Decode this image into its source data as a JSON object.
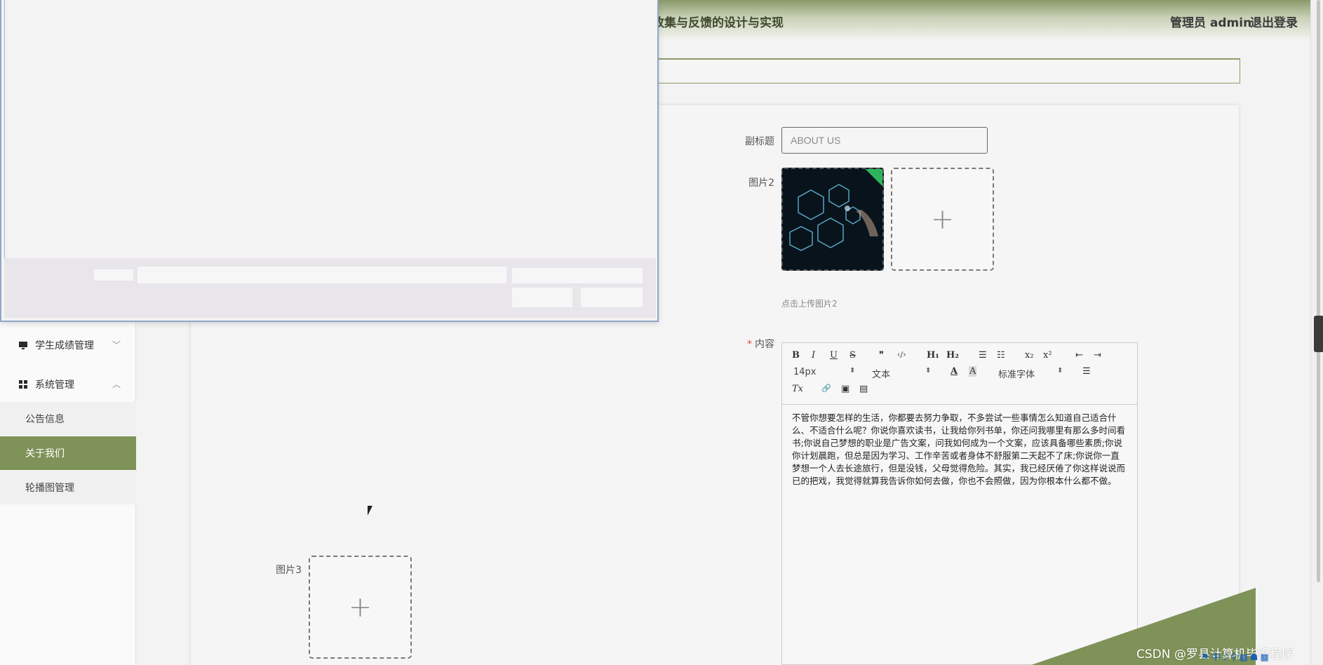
{
  "header": {
    "title": "收集与反馈的设计与实现",
    "user": "管理员 admin",
    "logout": "退出登录"
  },
  "sidebar": {
    "menus": [
      {
        "label": "学生成绩管理",
        "icon": "monitor-icon",
        "expanded": false
      },
      {
        "label": "系统管理",
        "icon": "grid-icon",
        "expanded": true
      }
    ],
    "subitems": [
      {
        "label": "公告信息",
        "active": false
      },
      {
        "label": "关于我们",
        "active": true
      },
      {
        "label": "轮播图管理",
        "active": false
      }
    ]
  },
  "form": {
    "subtitle_label": "副标题",
    "subtitle_value": "ABOUT US",
    "image2_label": "图片2",
    "image2_hint": "点击上传图片2",
    "image3_label": "图片3",
    "content_label": "内容",
    "content_required_mark": "*"
  },
  "editor": {
    "toolbar": {
      "bold": "B",
      "italic": "I",
      "underline": "U",
      "strike": "S",
      "quote": "❞",
      "code": "‹/›",
      "h1": "H₁",
      "h2": "H₂",
      "ol": "☰",
      "ul": "☷",
      "sub": "x₂",
      "sup": "x²",
      "outdent": "⇤",
      "indent": "⇥",
      "size": "14px",
      "header": "文本",
      "font": "标准字体",
      "clear": "Tx",
      "link": "🔗",
      "image": "▣",
      "video": "▤",
      "color": "A",
      "bg": "A",
      "align": "☰"
    },
    "content": "不管你想要怎样的生活，你都要去努力争取，不多尝试一些事情怎么知道自己适合什么、不适合什么呢？你说你喜欢读书，让我给你列书单，你还问我哪里有那么多时间看书;你说自己梦想的职业是广告文案，问我如何成为一个文案，应该具备哪些素质;你说你计划晨跑，但总是因为学习、工作辛苦或者身体不舒服第二天起不了床;你说你一直梦想一个人去长途旅行，但是没钱，父母觉得危险。其实，我已经厌倦了你这样说说而已的把戏，我觉得就算我告诉你如何去做，你也不会照做，因为你根本什么都不做。"
  },
  "watermark": "CSDN @罗县计算机毕设程序",
  "colors": {
    "accent": "#7f9258",
    "required": "#e04a3b"
  }
}
